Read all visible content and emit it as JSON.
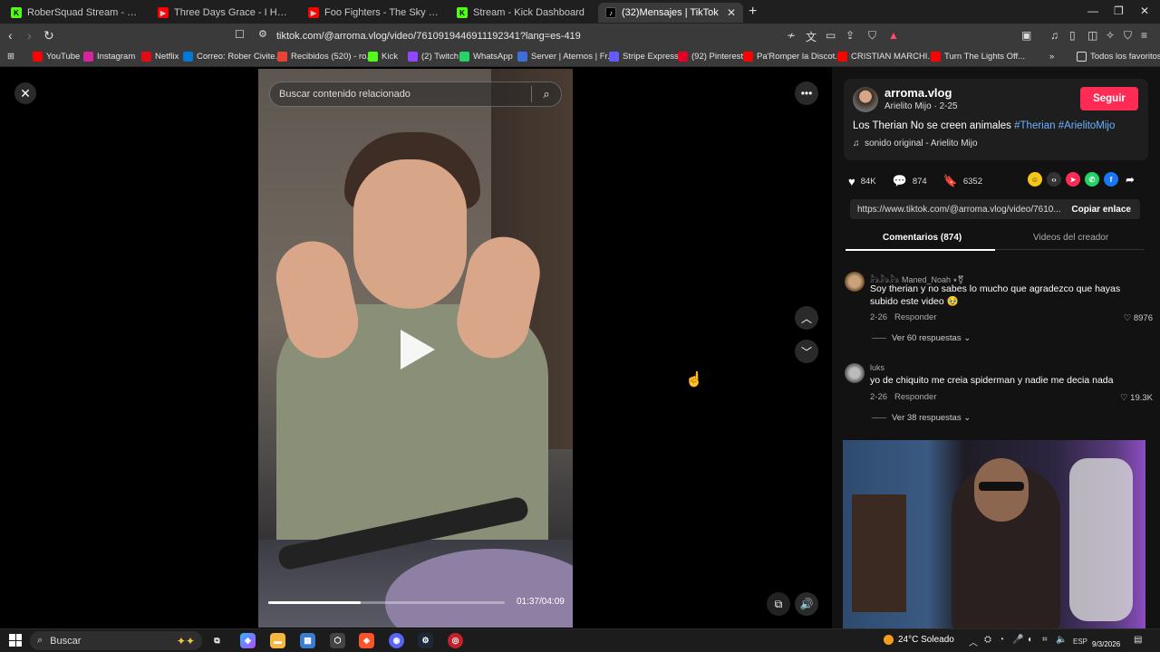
{
  "browser": {
    "tabs": [
      {
        "title": "RoberSquad Stream - Watch Live",
        "fav_color": "#53fc18",
        "fav_glyph": "K"
      },
      {
        "title": "Three Days Grace - I Hate Everything",
        "fav_color": "#ff0000",
        "fav_glyph": "▶"
      },
      {
        "title": "Foo Fighters - The Sky Is A Neighbor",
        "fav_color": "#ff0000",
        "fav_glyph": "▶"
      },
      {
        "title": "Stream - Kick Dashboard",
        "fav_color": "#53fc18",
        "fav_glyph": "K"
      },
      {
        "title": "(32)Mensajes | TikTok",
        "fav_color": "#000000",
        "fav_glyph": "♪",
        "active": true
      }
    ],
    "url": "tiktok.com/@arroma.vlog/video/7610919446911192341?lang=es-419",
    "bookmarks": [
      {
        "label": "YouTube",
        "color": "#ff0000"
      },
      {
        "label": "Instagram",
        "color": "#d6249f"
      },
      {
        "label": "Netflix",
        "color": "#e50914"
      },
      {
        "label": "Correo: Rober Civite...",
        "color": "#0078d4"
      },
      {
        "label": "Recibidos (520) - ro...",
        "color": "#ea4335"
      },
      {
        "label": "Kick",
        "color": "#53fc18"
      },
      {
        "label": "(2) Twitch",
        "color": "#9146ff"
      },
      {
        "label": "WhatsApp",
        "color": "#25d366"
      },
      {
        "label": "Server | Aternos | Fr...",
        "color": "#3d6fd6"
      },
      {
        "label": "Stripe Express",
        "color": "#635bff"
      },
      {
        "label": "(92) Pinterest",
        "color": "#e60023"
      },
      {
        "label": "Pa'Romper la Discot...",
        "color": "#ff0000"
      },
      {
        "label": "CRISTIAN MARCHI...",
        "color": "#ff0000"
      },
      {
        "label": "Turn The Lights Off...",
        "color": "#ff0000"
      }
    ],
    "all_favorites": "Todos los favoritos"
  },
  "video": {
    "search_placeholder": "Buscar contenido relacionado",
    "time": "01:37/04:09",
    "progress": 0.39
  },
  "creator": {
    "username": "arroma.vlog",
    "subtitle": "Arielito Mijo · 2-25",
    "follow_label": "Seguir",
    "description_text": "Los Therian No se creen animales ",
    "tags": [
      "#Therian",
      "#ArielitoMijo"
    ],
    "music": "sonido original - Arielito Mijo"
  },
  "stats": {
    "likes": "84K",
    "comments": "874",
    "saves": "6352"
  },
  "share": {
    "link": "https://www.tiktok.com/@arroma.vlog/video/7610...",
    "copy_label": "Copiar enlace"
  },
  "panel_tabs": {
    "comments": "Comentarios (874)",
    "creator_videos": "Videos del creador"
  },
  "comments": [
    {
      "user": "𓃦𓃦𓃦 Maned_Noah ⭑⚧",
      "text": "Soy therian y no sabes lo mucho que agradezco que hayas subido este video 🥹",
      "date": "2-26",
      "reply_label": "Responder",
      "likes": "8976",
      "replies": "Ver 60 respuestas"
    },
    {
      "user": "luks",
      "text": "yo de chiquito me creia spiderman y nadie me decia nada",
      "date": "2-26",
      "reply_label": "Responder",
      "likes": "19.3K",
      "replies": "Ver 38 respuestas"
    }
  ],
  "taskbar": {
    "search_label": "Buscar",
    "weather": "24°C Soleado",
    "language": "ESP",
    "date": "9/3/2026"
  }
}
